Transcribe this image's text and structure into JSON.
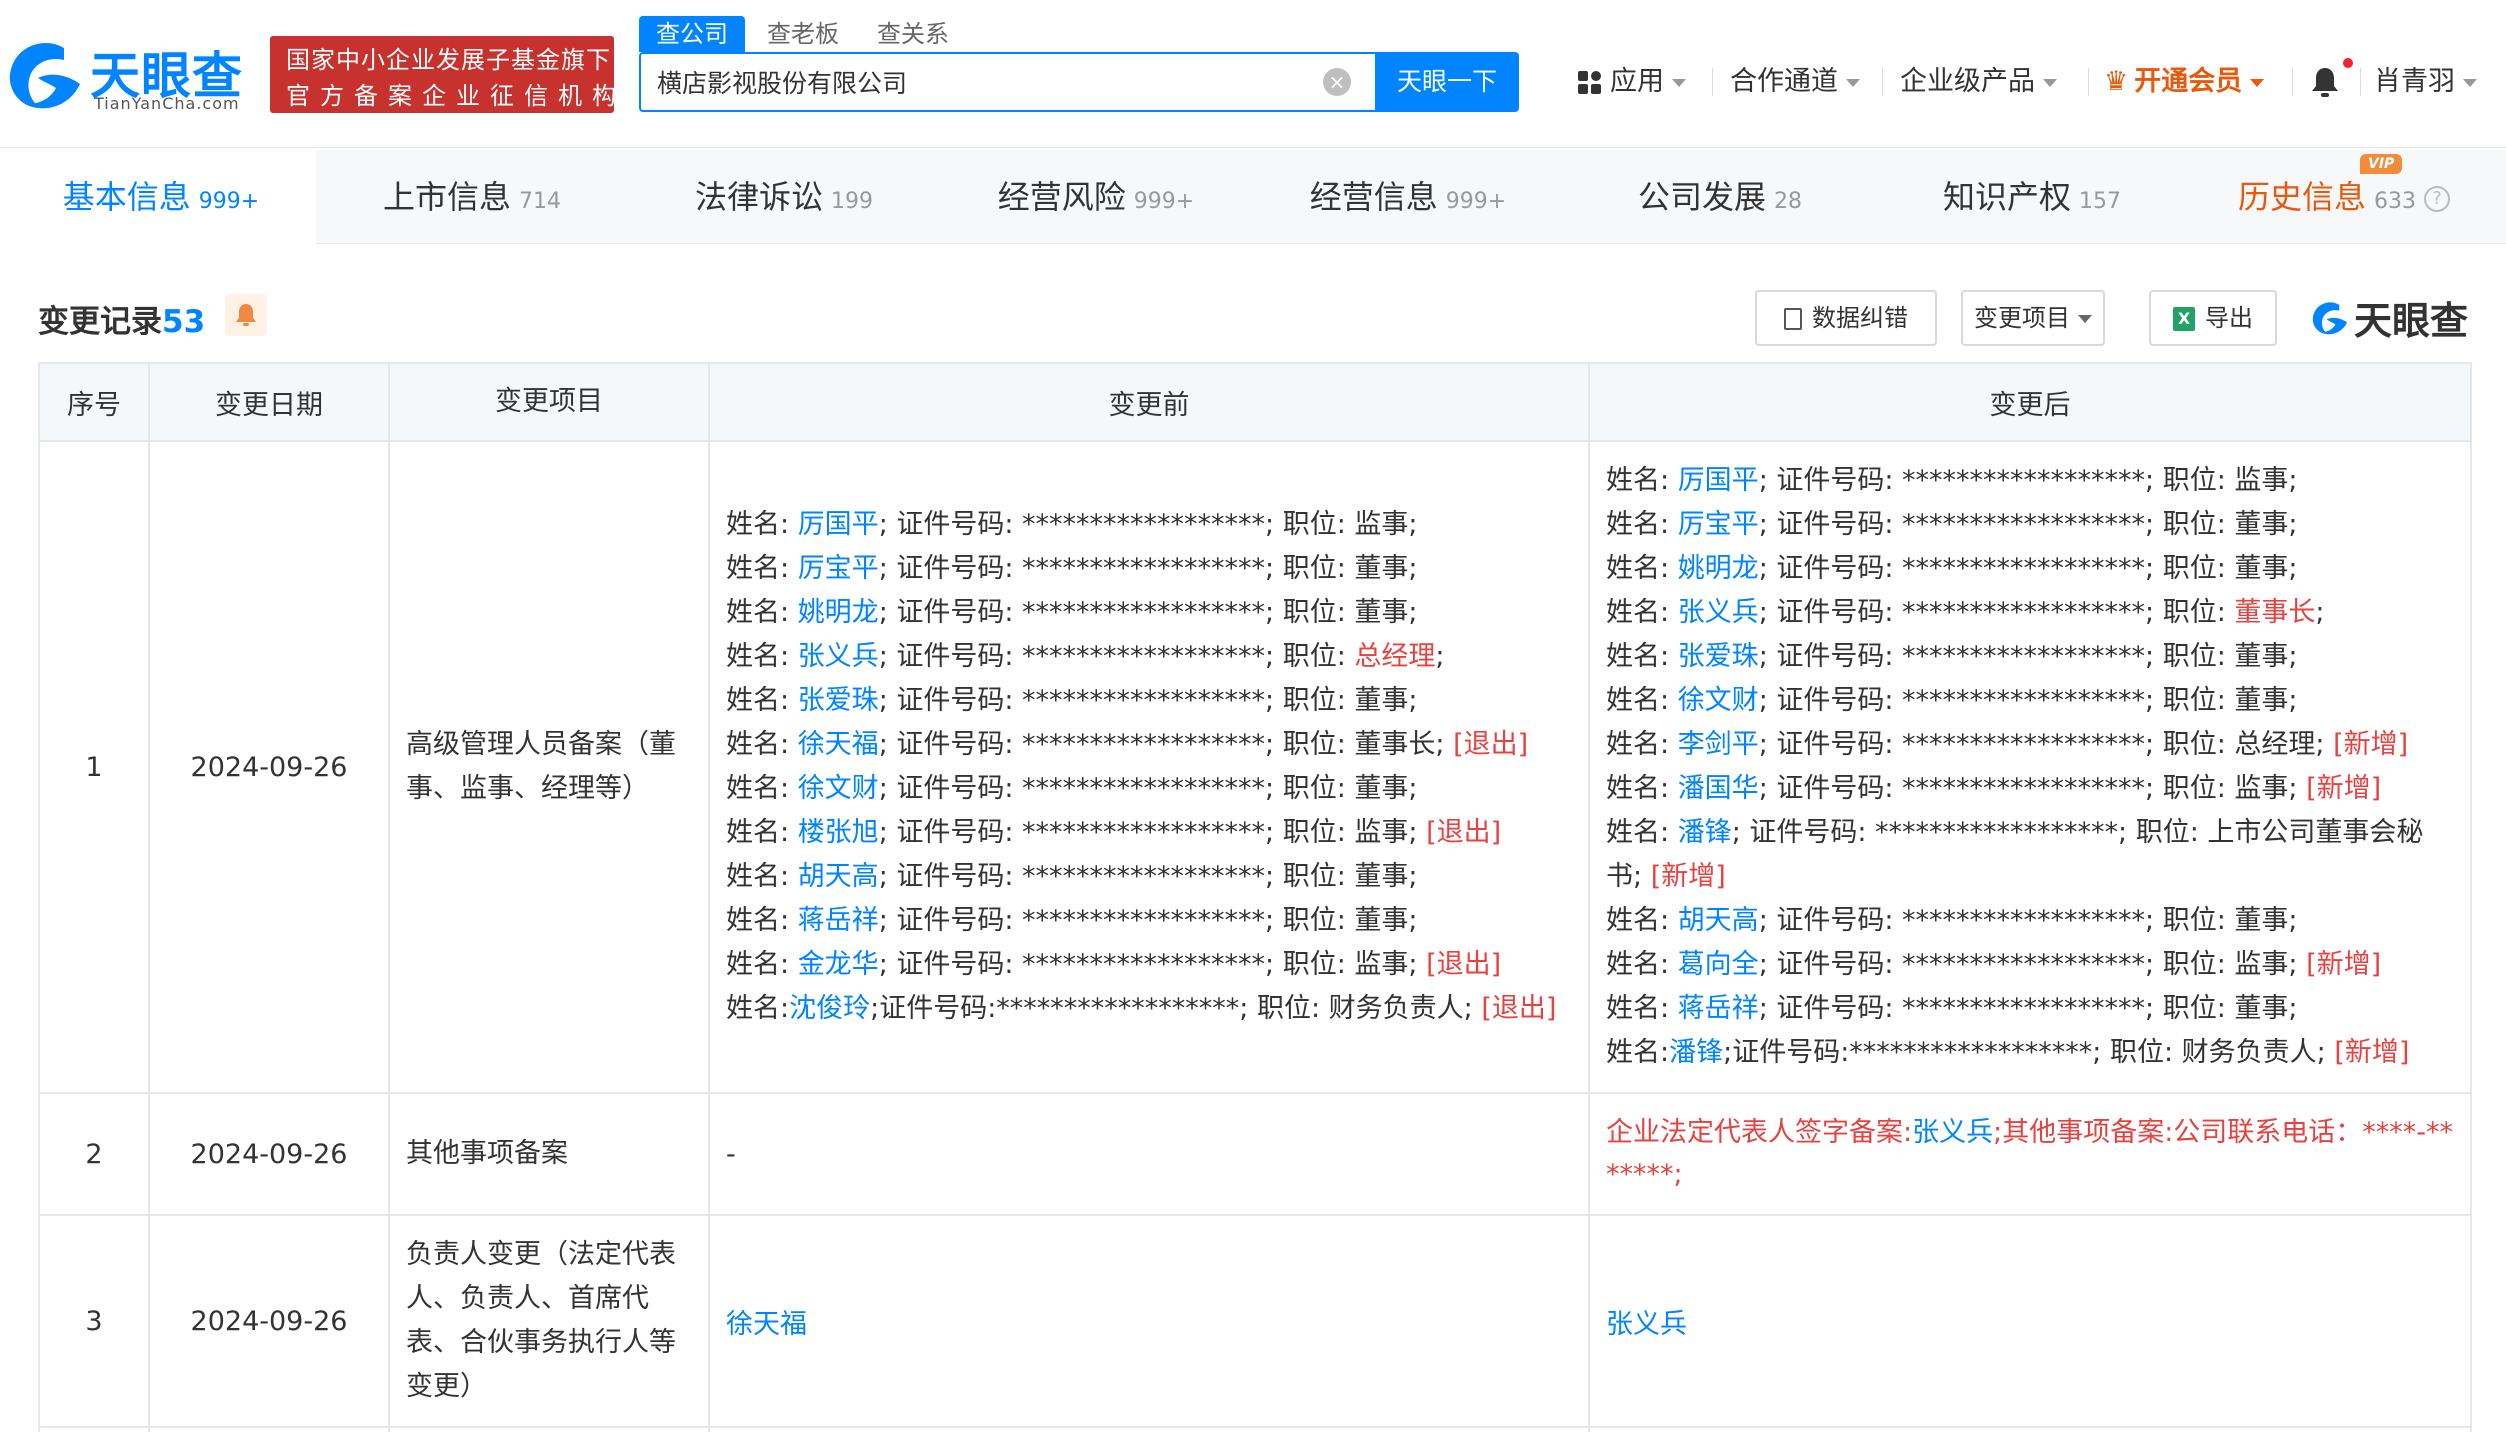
{
  "header": {
    "logo_text": "天眼查",
    "logo_sub": "TianYanCha.com",
    "badge_line1": "国家中小企业发展子基金旗下",
    "badge_line2": "官方备案企业征信机构",
    "search_tabs": [
      "查公司",
      "查老板",
      "查关系"
    ],
    "search_value": "横店影视股份有限公司",
    "search_button": "天眼一下",
    "nav": {
      "apps": "应用",
      "partner": "合作通道",
      "enterprise": "企业级产品",
      "vip": "开通会员",
      "user": "肖青羽"
    }
  },
  "tabs": [
    {
      "label": "基本信息",
      "count": "999+"
    },
    {
      "label": "上市信息",
      "count": "714"
    },
    {
      "label": "法律诉讼",
      "count": "199"
    },
    {
      "label": "经营风险",
      "count": "999+"
    },
    {
      "label": "经营信息",
      "count": "999+"
    },
    {
      "label": "公司发展",
      "count": "28"
    },
    {
      "label": "知识产权",
      "count": "157"
    },
    {
      "label": "历史信息",
      "count": "633",
      "tag": "VIP"
    }
  ],
  "section": {
    "title": "变更记录",
    "count": "53",
    "btn_correct": "数据纠错",
    "btn_filter": "变更项目",
    "btn_export": "导出",
    "brand": "天眼查"
  },
  "table": {
    "headers": [
      "序号",
      "变更日期",
      "变更项目",
      "变更前",
      "变更后"
    ],
    "rows": [
      {
        "idx": "1",
        "date": "2024-09-26",
        "item": "高级管理人员备案（董事、监事、经理等）",
        "before": [
          {
            "p": "姓名: ",
            "name": "厉国平",
            "m": "; 证件号码: ******************; 职位: ",
            "pos": "监事",
            "pos_red": false,
            "s": ";",
            "tag": ""
          },
          {
            "p": "姓名: ",
            "name": "厉宝平",
            "m": "; 证件号码: ******************; 职位: ",
            "pos": "董事",
            "pos_red": false,
            "s": ";",
            "tag": ""
          },
          {
            "p": "姓名: ",
            "name": "姚明龙",
            "m": "; 证件号码: ******************; 职位: ",
            "pos": "董事",
            "pos_red": false,
            "s": ";",
            "tag": ""
          },
          {
            "p": "姓名: ",
            "name": "张义兵",
            "m": "; 证件号码: ******************; 职位: ",
            "pos": "总经理",
            "pos_red": true,
            "s": ";",
            "tag": ""
          },
          {
            "p": "姓名: ",
            "name": "张爱珠",
            "m": "; 证件号码: ******************; 职位: ",
            "pos": "董事",
            "pos_red": false,
            "s": ";",
            "tag": ""
          },
          {
            "p": "姓名: ",
            "name": "徐天福",
            "m": "; 证件号码: ******************; 职位: ",
            "pos": "董事长",
            "pos_red": false,
            "s": "; ",
            "tag": "[退出]"
          },
          {
            "p": "姓名: ",
            "name": "徐文财",
            "m": "; 证件号码: ******************; 职位: ",
            "pos": "董事",
            "pos_red": false,
            "s": ";",
            "tag": ""
          },
          {
            "p": "姓名: ",
            "name": "楼张旭",
            "m": "; 证件号码: ******************; 职位: ",
            "pos": "监事",
            "pos_red": false,
            "s": "; ",
            "tag": "[退出]"
          },
          {
            "p": "姓名: ",
            "name": "胡天高",
            "m": "; 证件号码: ******************; 职位: ",
            "pos": "董事",
            "pos_red": false,
            "s": ";",
            "tag": ""
          },
          {
            "p": "姓名: ",
            "name": "蒋岳祥",
            "m": "; 证件号码: ******************; 职位: ",
            "pos": "董事",
            "pos_red": false,
            "s": ";",
            "tag": ""
          },
          {
            "p": "姓名: ",
            "name": "金龙华",
            "m": "; 证件号码: ******************; 职位: ",
            "pos": "监事",
            "pos_red": false,
            "s": "; ",
            "tag": "[退出]"
          },
          {
            "p": "姓名:",
            "name": "沈俊玲",
            "m": ";证件号码:******************; 职位: ",
            "pos": "财务负责人",
            "pos_red": false,
            "s": "; ",
            "tag": "[退出]"
          }
        ],
        "after": [
          {
            "p": "姓名: ",
            "name": "厉国平",
            "m": "; 证件号码: ******************; 职位: ",
            "pos": "监事",
            "pos_red": false,
            "s": ";",
            "tag": ""
          },
          {
            "p": "姓名: ",
            "name": "厉宝平",
            "m": "; 证件号码: ******************; 职位: ",
            "pos": "董事",
            "pos_red": false,
            "s": ";",
            "tag": ""
          },
          {
            "p": "姓名: ",
            "name": "姚明龙",
            "m": "; 证件号码: ******************; 职位: ",
            "pos": "董事",
            "pos_red": false,
            "s": ";",
            "tag": ""
          },
          {
            "p": "姓名: ",
            "name": "张义兵",
            "m": "; 证件号码: ******************; 职位: ",
            "pos": "董事长",
            "pos_red": true,
            "s": ";",
            "tag": ""
          },
          {
            "p": "姓名: ",
            "name": "张爱珠",
            "m": "; 证件号码: ******************; 职位: ",
            "pos": "董事",
            "pos_red": false,
            "s": ";",
            "tag": ""
          },
          {
            "p": "姓名: ",
            "name": "徐文财",
            "m": "; 证件号码: ******************; 职位: ",
            "pos": "董事",
            "pos_red": false,
            "s": ";",
            "tag": ""
          },
          {
            "p": "姓名: ",
            "name": "李剑平",
            "m": "; 证件号码: ******************; 职位: ",
            "pos": "总经理",
            "pos_red": false,
            "s": "; ",
            "tag": "[新增]"
          },
          {
            "p": "姓名: ",
            "name": "潘国华",
            "m": "; 证件号码: ******************; 职位: ",
            "pos": "监事",
            "pos_red": false,
            "s": "; ",
            "tag": "[新增]"
          },
          {
            "p": "姓名: ",
            "name": "潘锋",
            "m": "; 证件号码: ******************; 职位: ",
            "pos": "上市公司董事会秘书",
            "pos_red": false,
            "s": "; ",
            "tag": "[新增]",
            "wrap": true
          },
          {
            "p": "姓名: ",
            "name": "胡天高",
            "m": "; 证件号码: ******************; 职位: ",
            "pos": "董事",
            "pos_red": false,
            "s": ";",
            "tag": ""
          },
          {
            "p": "姓名: ",
            "name": "葛向全",
            "m": "; 证件号码: ******************; 职位: ",
            "pos": "监事",
            "pos_red": false,
            "s": "; ",
            "tag": "[新增]"
          },
          {
            "p": "姓名: ",
            "name": "蒋岳祥",
            "m": "; 证件号码: ******************; 职位: ",
            "pos": "董事",
            "pos_red": false,
            "s": ";",
            "tag": ""
          },
          {
            "p": "姓名:",
            "name": "潘锋",
            "m": ";证件号码:******************; 职位: ",
            "pos": "财务负责人",
            "pos_red": false,
            "s": "; ",
            "tag": "[新增]"
          }
        ]
      },
      {
        "idx": "2",
        "date": "2024-09-26",
        "item": "其他事项备案",
        "before_text": "-",
        "after_prefix": "企业法定代表人签字备案:",
        "after_name": "张义兵",
        "after_suffix": ";其他事项备案:公司联系电话：****-*******;"
      },
      {
        "idx": "3",
        "date": "2024-09-26",
        "item": "负责人变更（法定代表人、负责人、首席代表、合伙事务执行人等变更）",
        "before_name": "徐天福",
        "after_name": "张义兵"
      }
    ]
  },
  "colors": {
    "brand_blue": "#0084ff",
    "badge_red": "#c8322e",
    "highlight_red": "#e64340",
    "vip_orange": "#e8590c"
  }
}
